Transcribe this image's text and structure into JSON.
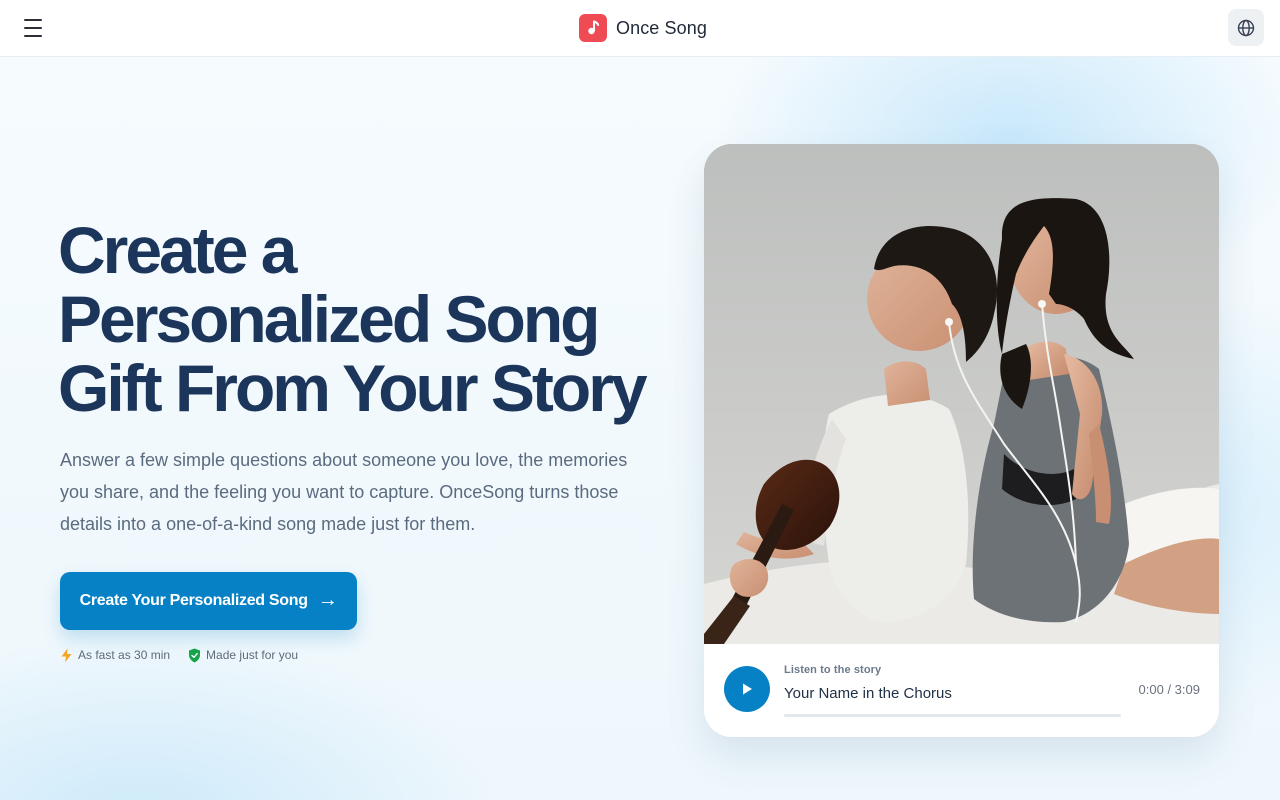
{
  "header": {
    "brand_name": "Once Song",
    "menu_icon": "hamburger-menu-icon",
    "logo_icon": "music-note-icon",
    "language_icon": "globe-icon"
  },
  "hero": {
    "title_lines": [
      "Create a",
      "Personalized Song",
      "Gift From Your Story"
    ],
    "description": "Answer a few simple questions about someone you love, the memories you share, and the feeling you want to capture. OnceSong turns those details into a one-of-a-kind song made just for them.",
    "cta_label": "Create Your Personalized Song",
    "cta_arrow": "→",
    "badges": [
      {
        "icon": "lightning-icon",
        "label": "As fast as 30 min"
      },
      {
        "icon": "shield-check-icon",
        "label": "Made just for you"
      }
    ]
  },
  "player": {
    "kicker": "Listen to the story",
    "title": "Your Name in the Chorus",
    "time": "0:00 / 3:09",
    "progress": 0,
    "play_icon": "play-icon"
  },
  "colors": {
    "primary": "#0781c6",
    "title": "#1c355a",
    "brand_logo": "#ef4b55",
    "lightning": "#f5a524",
    "shield": "#16a34a"
  }
}
